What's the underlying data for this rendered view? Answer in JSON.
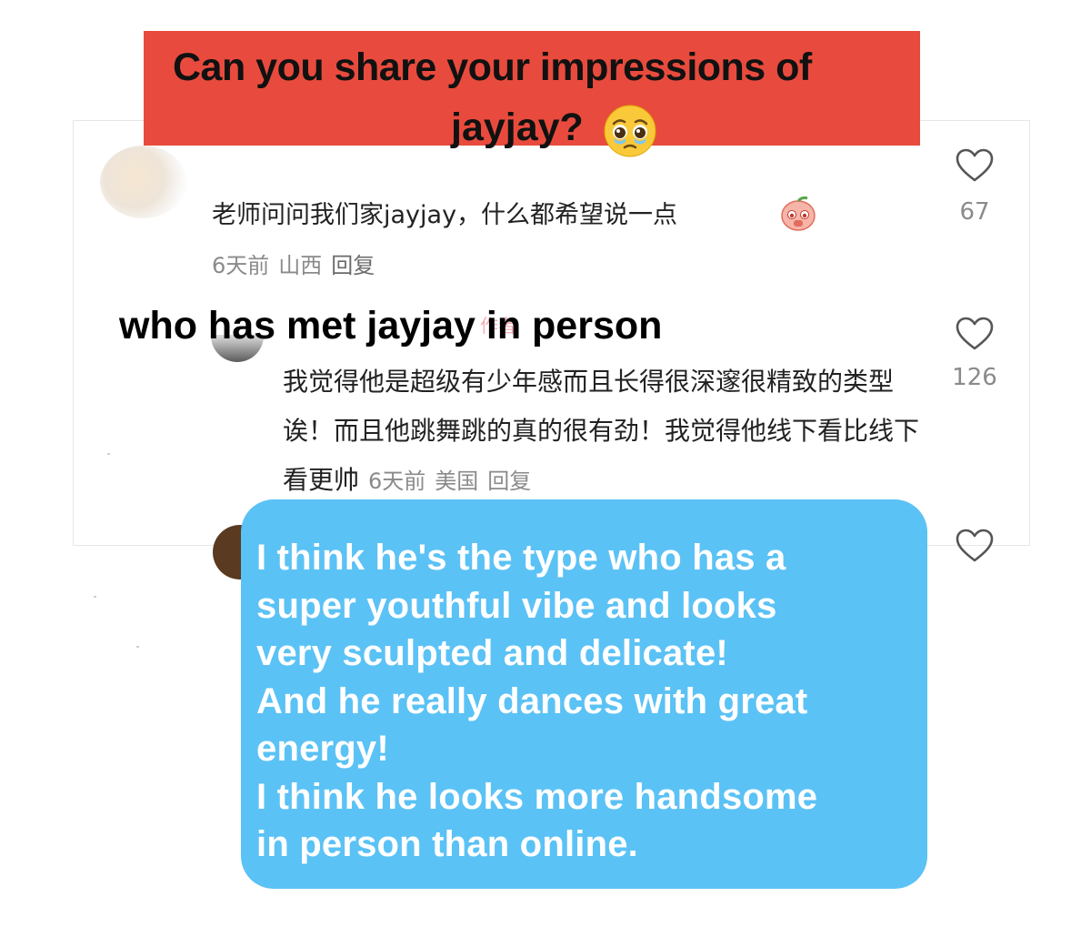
{
  "question": {
    "line1": "Can you share  your impressions of",
    "line2": "jayjay?",
    "emoji": "pleading-face-icon"
  },
  "comment1": {
    "text": "老师问问我们家jayjay，什么都希望说一点",
    "emoji": "peach-pleading-icon",
    "time": "6天前",
    "location": "山西",
    "reply": "回复",
    "likes": "67"
  },
  "overlay_title": "who has met jayjay in person",
  "comment2": {
    "author_badge": "作者",
    "text": "我觉得他是超级有少年感而且长得很深邃很精致的类型诶！而且他跳舞跳的真的很有劲！我觉得他线下看比线下看更帅",
    "time": "6天前",
    "location": "美国",
    "reply": "回复",
    "likes": "126"
  },
  "translation": {
    "lines": [
      "I think he's the type who has a",
      "super youthful vibe and looks",
      "very sculpted and delicate!",
      "And he really dances with great",
      "energy!",
      "I think he looks more handsome",
      "in person than online."
    ]
  },
  "colors": {
    "banner_red": "#e84b3d",
    "bubble_blue": "#5bc2f5",
    "meta_gray": "#8a8a8a"
  }
}
